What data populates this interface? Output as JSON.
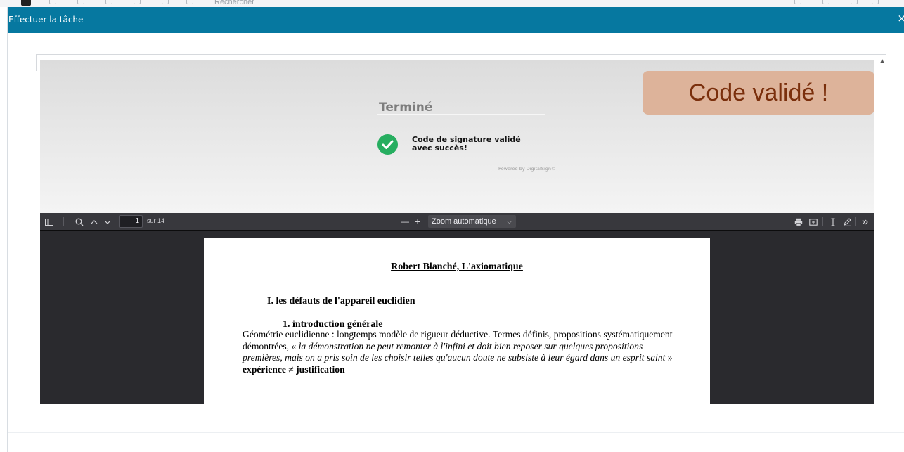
{
  "background": {
    "search_placeholder": "Rechercher"
  },
  "modal": {
    "title": "Effectuer la tâche",
    "close_label": "×"
  },
  "signature": {
    "status_title": "Terminé",
    "success_message_line1": "Code de signature validé",
    "success_message_line2": "avec succès!",
    "powered_by": "Powered by DigitalSign©",
    "badge_text": "Code validé !",
    "colors": {
      "check": "#27ae60",
      "badge_bg": "#ddb39a",
      "badge_text": "#7a2f0c"
    }
  },
  "pdf_toolbar": {
    "current_page": "1",
    "page_of": "sur 14",
    "zoom_out": "—",
    "zoom_in": "+",
    "zoom_label": "Zoom automatique",
    "icons": [
      "sidebar-toggle-icon",
      "search-icon",
      "chevron-up-icon",
      "chevron-down-icon",
      "print-icon",
      "open-file-icon",
      "text-cursor-icon",
      "draw-icon",
      "double-chevron-right-icon"
    ]
  },
  "pdf_document": {
    "title": "Robert Blanché, L'axiomatique",
    "heading1": "I.   les défauts de l'appareil euclidien",
    "heading2": "1.   introduction générale",
    "paragraph_plain": "Géométrie euclidienne : longtemps modèle de rigueur déductive. Termes définis, propositions systématiquement démontrées, « ",
    "paragraph_italic": "la démonstration ne peut remonter à l'infini et doit bien reposer sur quelques propositions premières, mais on a pris soin de les choisir telles qu'aucun doute ne subsiste à leur égard dans un esprit saint",
    "paragraph_end": " »",
    "bold_line": "expérience ≠ justification"
  },
  "colors": {
    "header": "#0678a0",
    "pdf_bg": "#2a2a2e",
    "pdf_toolbar": "#38383d"
  }
}
